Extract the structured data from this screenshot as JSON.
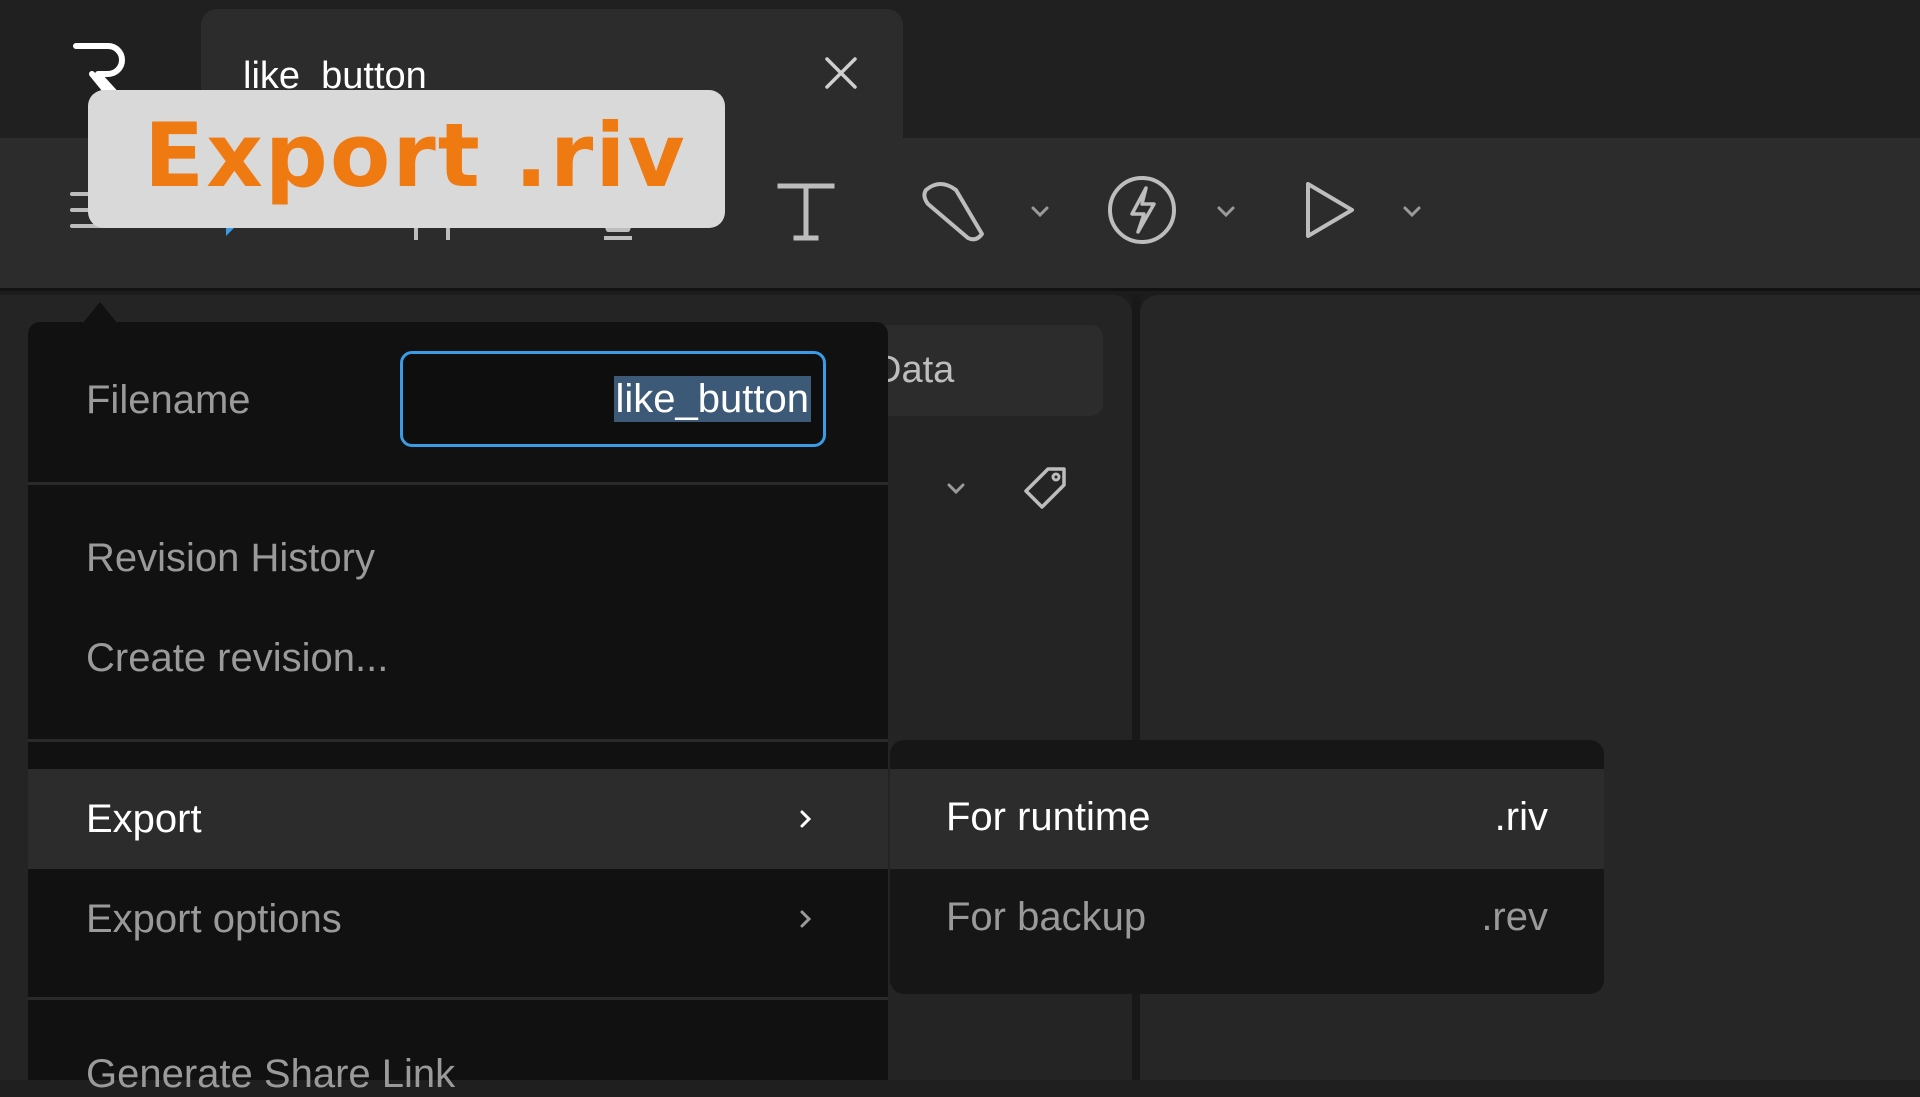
{
  "app": {
    "logo_icon": "rive-logo-icon"
  },
  "tab": {
    "title": "like_button",
    "close_icon": "close-icon"
  },
  "toolbar": {
    "tools": [
      {
        "icon": "hamburger-menu-icon"
      },
      {
        "icon": "select-arrow-icon"
      },
      {
        "icon": "frame-icon"
      },
      {
        "icon": "pen-icon"
      },
      {
        "icon": "text-icon"
      },
      {
        "icon": "shape-icon"
      },
      {
        "icon": "bolt-icon"
      },
      {
        "icon": "play-icon"
      }
    ]
  },
  "side_tab": {
    "label": "Data"
  },
  "main_menu": {
    "filename_label": "Filename",
    "filename_value": "like_button",
    "revision_history": "Revision History",
    "create_revision": "Create revision...",
    "export": "Export",
    "export_options": "Export options",
    "generate_share_link": "Generate Share Link"
  },
  "export_submenu": {
    "items": [
      {
        "label": "For runtime",
        "ext": ".riv"
      },
      {
        "label": "For backup",
        "ext": ".rev"
      }
    ]
  },
  "overlay": {
    "caption": "Export .riv"
  },
  "colors": {
    "accent_blue": "#3a9be6",
    "overlay_orange": "#f07a12",
    "menu_bg": "#111111"
  }
}
